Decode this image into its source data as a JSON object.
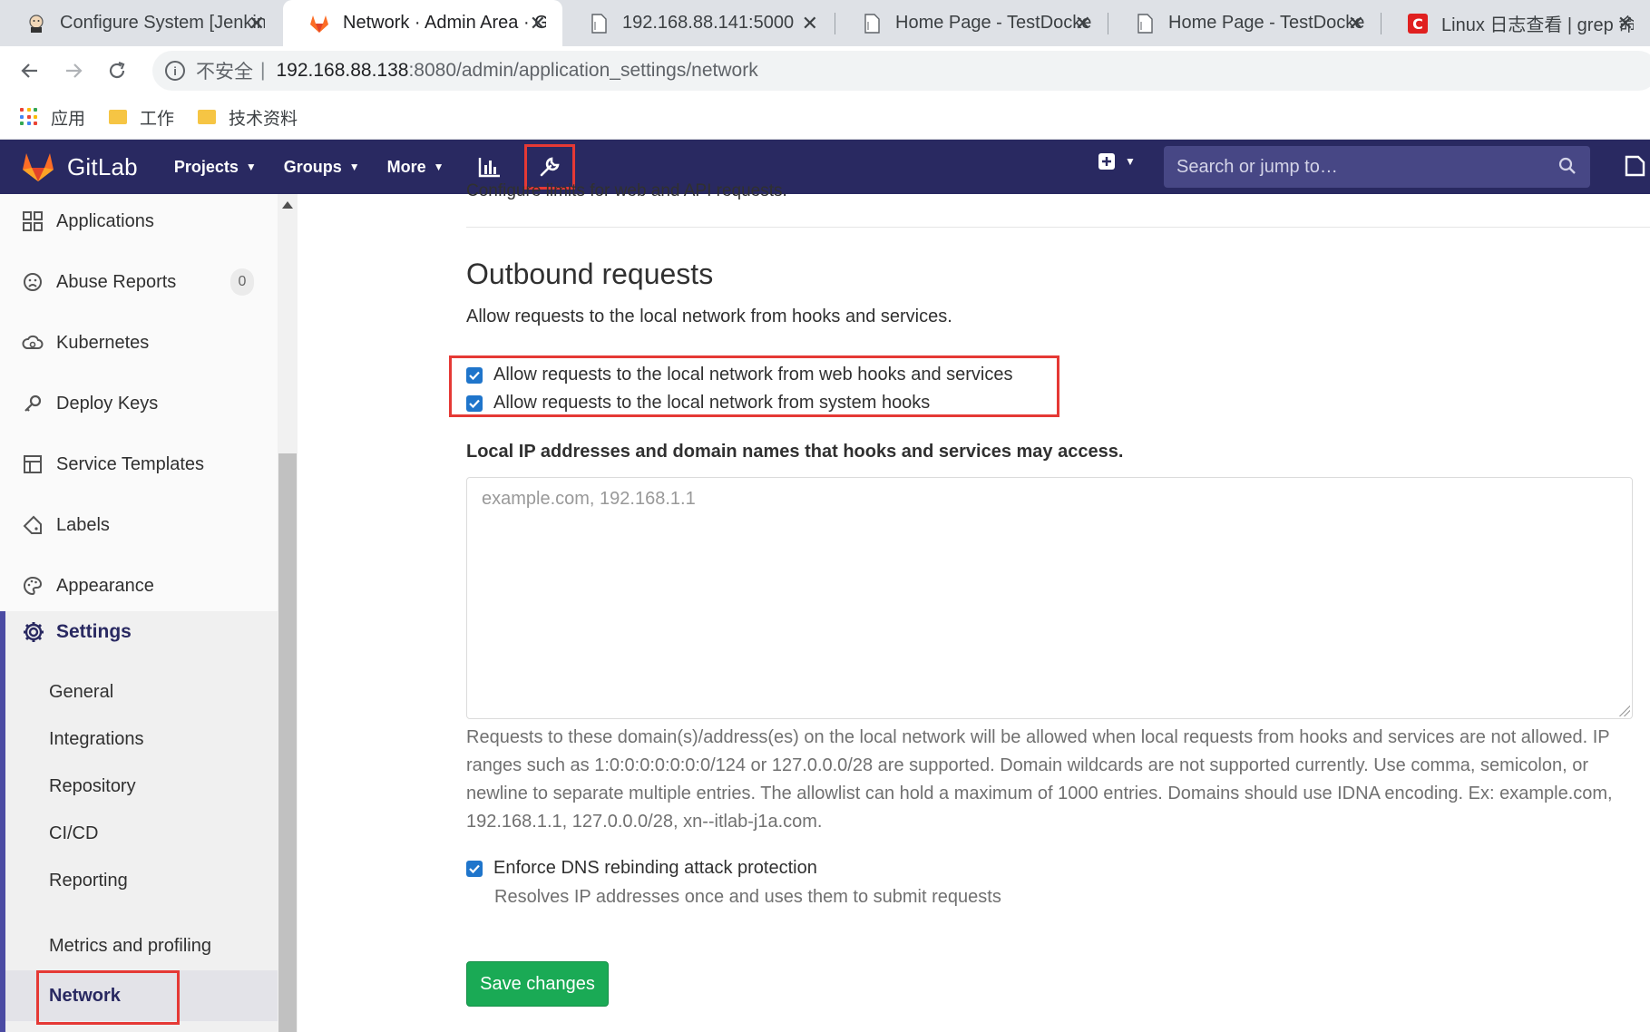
{
  "browser": {
    "tabs": [
      {
        "title": "Configure System [Jenkins]",
        "icon": "jenkins-icon",
        "active": false
      },
      {
        "title": "Network · Admin Area · GitLab",
        "icon": "gitlab-icon",
        "active": true
      },
      {
        "title": "192.168.88.141:5000",
        "icon": "page-icon",
        "active": false
      },
      {
        "title": "Home Page - TestDocker",
        "icon": "page-icon",
        "active": false
      },
      {
        "title": "Home Page - TestDocker",
        "icon": "page-icon",
        "active": false
      },
      {
        "title": "Linux 日志查看 | grep 命令",
        "icon": "csdn-icon",
        "active": false
      }
    ],
    "insecure_label": "不安全",
    "url_host": "192.168.88.138",
    "url_path": ":8080/admin/application_settings/network",
    "bookmarks": [
      "应用",
      "工作",
      "技术资料"
    ]
  },
  "header": {
    "brand": "GitLab",
    "nav": [
      "Projects",
      "Groups",
      "More"
    ],
    "search_placeholder": "Search or jump to…"
  },
  "sidebar": {
    "items": [
      {
        "label": "Applications",
        "icon": "applications-icon"
      },
      {
        "label": "Abuse Reports",
        "icon": "abuse-icon",
        "badge": "0"
      },
      {
        "label": "Kubernetes",
        "icon": "kubernetes-icon"
      },
      {
        "label": "Deploy Keys",
        "icon": "key-icon"
      },
      {
        "label": "Service Templates",
        "icon": "template-icon"
      },
      {
        "label": "Labels",
        "icon": "label-icon"
      },
      {
        "label": "Appearance",
        "icon": "palette-icon"
      }
    ],
    "settings_label": "Settings",
    "settings_sub": [
      "General",
      "Integrations",
      "Repository",
      "CI/CD",
      "Reporting",
      "Metrics and profiling",
      "Network"
    ],
    "active_sub": "Network"
  },
  "main": {
    "cut_text": "Configure limits for web and API requests.",
    "section_title": "Outbound requests",
    "section_desc": "Allow requests to the local network from hooks and services.",
    "checkbox_webhooks": "Allow requests to the local network from web hooks and services",
    "checkbox_systemhooks": "Allow requests to the local network from system hooks",
    "allowlist_label": "Local IP addresses and domain names that hooks and services may access.",
    "allowlist_placeholder": "example.com, 192.168.1.1",
    "allowlist_help": "Requests to these domain(s)/address(es) on the local network will be allowed when local requests from hooks and services are not allowed. IP ranges such as 1:0:0:0:0:0:0:0/124 or 127.0.0.0/28 are supported. Domain wildcards are not supported currently. Use comma, semicolon, or newline to separate multiple entries. The allowlist can hold a maximum of 1000 entries. Domains should use IDNA encoding. Ex: example.com, 192.168.1.1, 127.0.0.0/28, xn--itlab-j1a.com.",
    "dns_label": "Enforce DNS rebinding attack protection",
    "dns_help": "Resolves IP addresses once and uses them to submit requests",
    "save_label": "Save changes"
  },
  "colors": {
    "header_bg": "#292961",
    "accent": "#1f75cb",
    "save_green": "#1aaa55",
    "highlight_red": "#e53935"
  }
}
